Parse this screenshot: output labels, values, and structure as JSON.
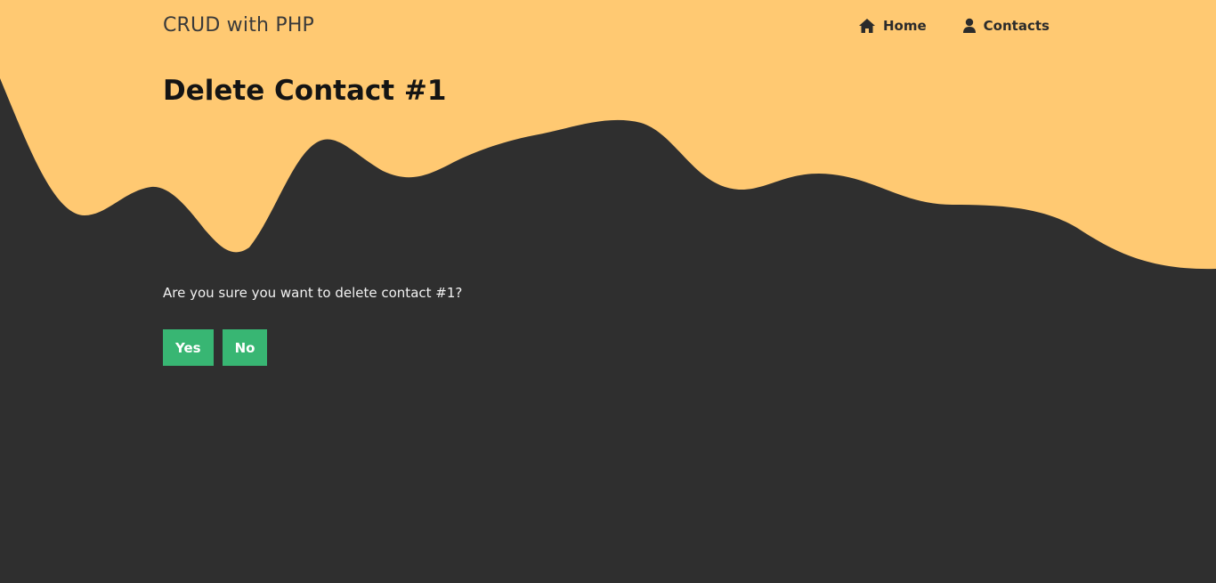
{
  "colors": {
    "header_wave": "#ffc972",
    "background": "#2f2f2f",
    "button": "#38b673"
  },
  "nav": {
    "brand": "CRUD with PHP",
    "links": [
      {
        "icon": "home-icon",
        "label": "Home"
      },
      {
        "icon": "user-icon",
        "label": "Contacts"
      }
    ]
  },
  "main": {
    "title": "Delete Contact #1",
    "message": "Are you sure you want to delete contact #1?",
    "buttons": {
      "yes": "Yes",
      "no": "No"
    }
  }
}
